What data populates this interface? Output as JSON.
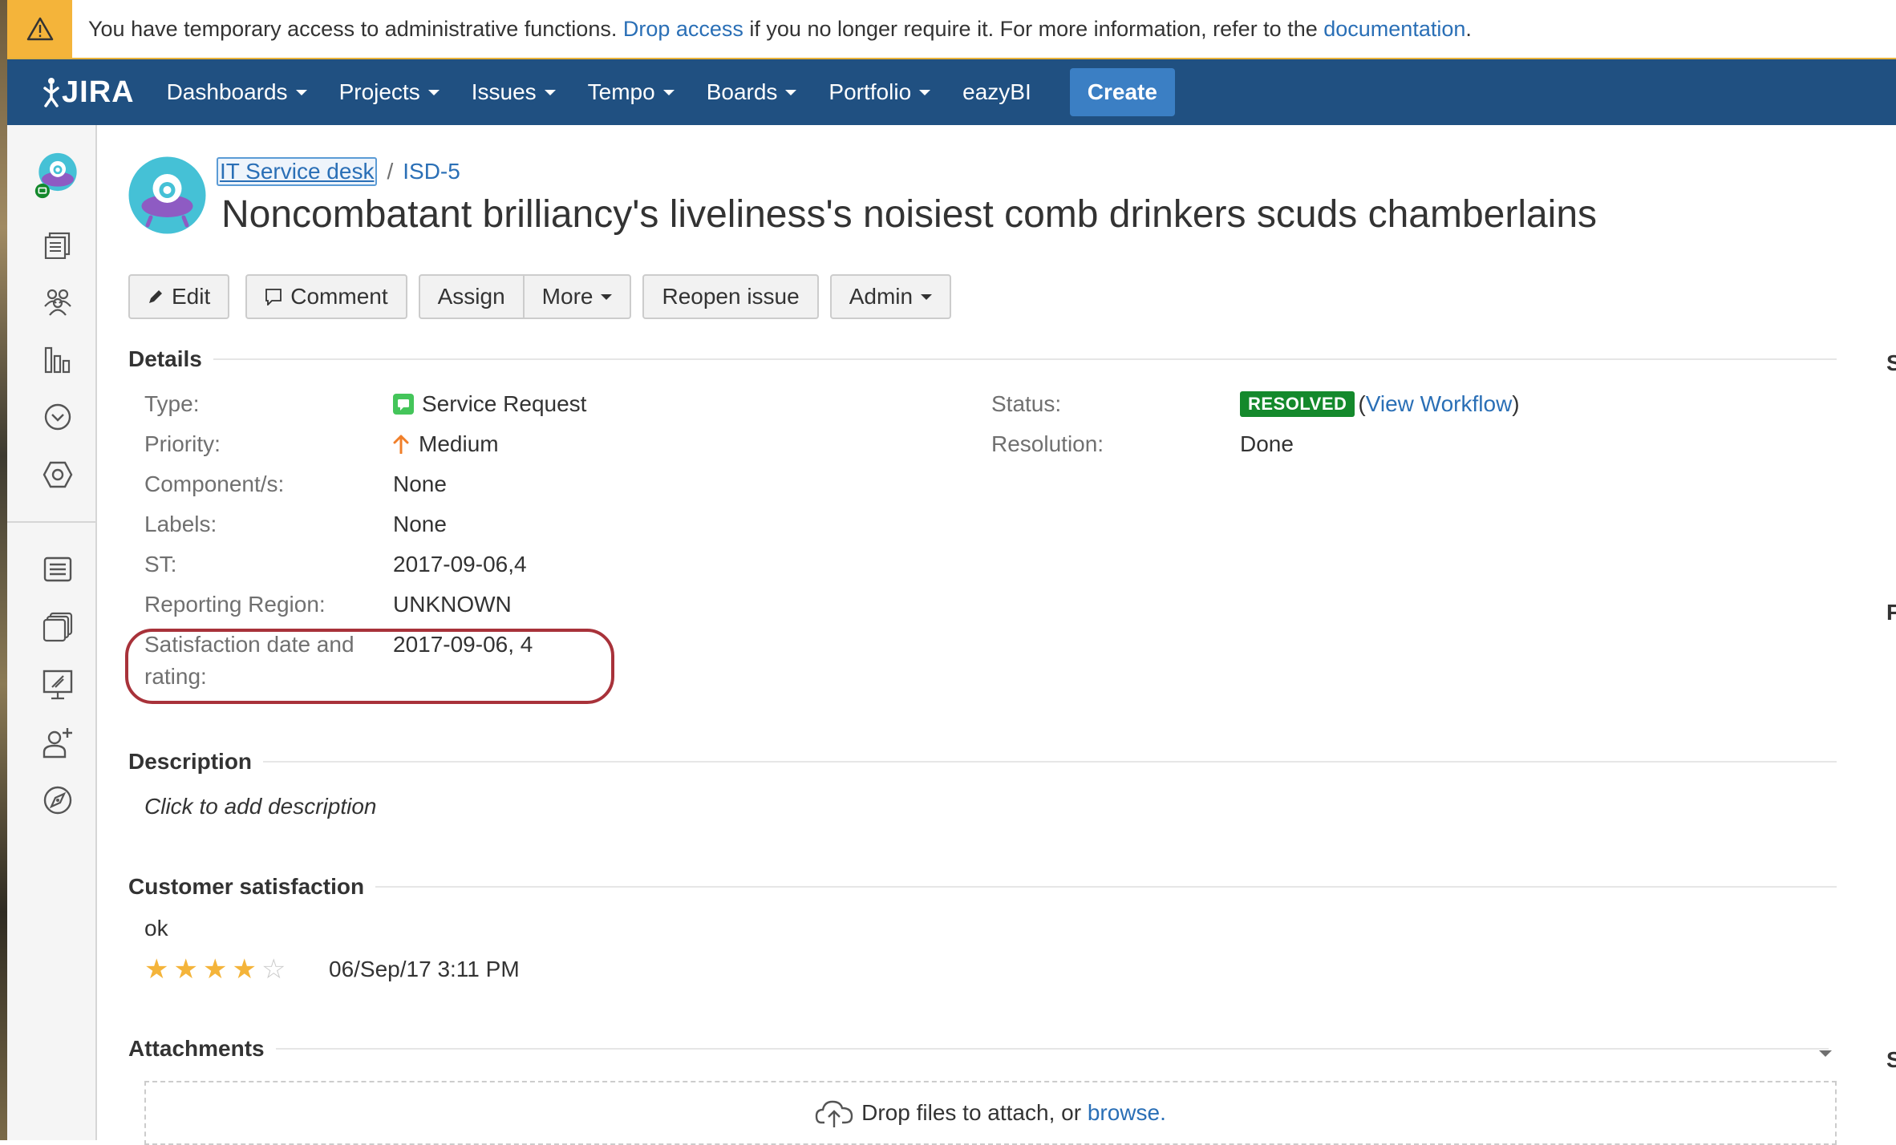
{
  "banner": {
    "text_before": "You have temporary access to administrative functions. ",
    "drop_access_link": "Drop access",
    "text_middle": " if you no longer require it. For more information, refer to the ",
    "documentation_link": "documentation",
    "text_after": "."
  },
  "nav": {
    "logo_text": "JIRA",
    "items": [
      "Dashboards",
      "Projects",
      "Issues",
      "Tempo",
      "Boards",
      "Portfolio",
      "eazyBI"
    ],
    "create_label": "Create"
  },
  "sidebar": {
    "icons": [
      "project-avatar-icon",
      "queues-icon",
      "customers-icon",
      "reports-icon",
      "sla-icon",
      "settings-icon",
      "issues-list-icon",
      "knowledge-base-icon",
      "portal-icon",
      "invite-team-icon",
      "compass-icon"
    ]
  },
  "breadcrumb": {
    "project": "IT Service desk",
    "separator": "/",
    "issue_key": "ISD-5"
  },
  "issue": {
    "title": "Noncombatant brilliancy's liveliness's noisiest comb drinkers scuds chamberlains"
  },
  "toolbar": {
    "edit": "Edit",
    "comment": "Comment",
    "assign": "Assign",
    "more": "More",
    "reopen": "Reopen issue",
    "admin": "Admin"
  },
  "details": {
    "heading": "Details",
    "type_label": "Type:",
    "type_value": "Service Request",
    "priority_label": "Priority:",
    "priority_value": "Medium",
    "components_label": "Component/s:",
    "components_value": "None",
    "labels_label": "Labels:",
    "labels_value": "None",
    "st_label": "ST:",
    "st_value": "2017-09-06,4",
    "region_label": "Reporting Region:",
    "region_value": "UNKNOWN",
    "satisfaction_label_line1": "Satisfaction date and",
    "satisfaction_label_line2": "rating:",
    "satisfaction_value": "2017-09-06, 4",
    "status_label": "Status:",
    "status_value": "RESOLVED",
    "view_workflow_open": "(",
    "view_workflow": "View Workflow",
    "view_workflow_close": ")",
    "resolution_label": "Resolution:",
    "resolution_value": "Done"
  },
  "description": {
    "heading": "Description",
    "placeholder": "Click to add description"
  },
  "customer_satisfaction": {
    "heading": "Customer satisfaction",
    "comment": "ok",
    "rating": 4,
    "rating_max": 5,
    "date": "06/Sep/17 3:11 PM"
  },
  "attachments": {
    "heading": "Attachments",
    "drop_text": "Drop files to attach, or",
    "browse_link": "browse."
  },
  "right_edge": {
    "letter1": "S",
    "letter2": "F",
    "letter3": "S"
  },
  "colors": {
    "nav_bg": "#205081",
    "create_bg": "#3b7fc4",
    "status_green": "#14892c",
    "link": "#2a6fb6",
    "warning": "#f4b43a",
    "highlight": "#a8323a"
  }
}
